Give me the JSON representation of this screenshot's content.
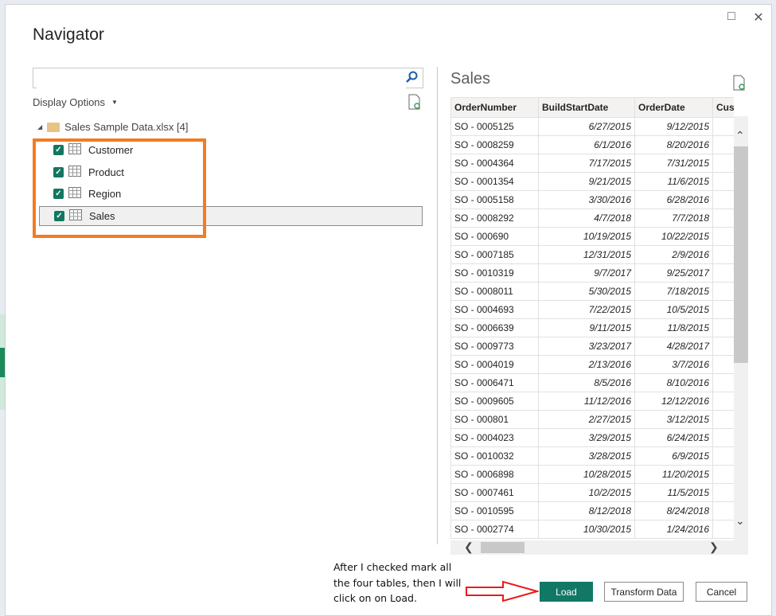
{
  "dialog": {
    "title": "Navigator",
    "restore_icon": "restore-icon",
    "close_icon": "close-icon"
  },
  "left": {
    "search": {
      "value": "",
      "placeholder": ""
    },
    "display_options": "Display Options",
    "tree_root": "Sales Sample Data.xlsx [4]",
    "items": [
      {
        "label": "Customer",
        "checked": true
      },
      {
        "label": "Product",
        "checked": true
      },
      {
        "label": "Region",
        "checked": true
      },
      {
        "label": "Sales",
        "checked": true,
        "selected": true
      }
    ]
  },
  "preview": {
    "title": "Sales",
    "columns": [
      "OrderNumber",
      "BuildStartDate",
      "OrderDate",
      "Custom"
    ],
    "rows": [
      [
        "SO - 0005125",
        "6/27/2015",
        "9/12/2015"
      ],
      [
        "SO - 0008259",
        "6/1/2016",
        "8/20/2016"
      ],
      [
        "SO - 0004364",
        "7/17/2015",
        "7/31/2015"
      ],
      [
        "SO - 0001354",
        "9/21/2015",
        "11/6/2015"
      ],
      [
        "SO - 0005158",
        "3/30/2016",
        "6/28/2016"
      ],
      [
        "SO - 0008292",
        "4/7/2018",
        "7/7/2018"
      ],
      [
        "SO - 000690",
        "10/19/2015",
        "10/22/2015"
      ],
      [
        "SO - 0007185",
        "12/31/2015",
        "2/9/2016"
      ],
      [
        "SO - 0010319",
        "9/7/2017",
        "9/25/2017"
      ],
      [
        "SO - 0008011",
        "5/30/2015",
        "7/18/2015"
      ],
      [
        "SO - 0004693",
        "7/22/2015",
        "10/5/2015"
      ],
      [
        "SO - 0006639",
        "9/11/2015",
        "11/8/2015"
      ],
      [
        "SO - 0009773",
        "3/23/2017",
        "4/28/2017"
      ],
      [
        "SO - 0004019",
        "2/13/2016",
        "3/7/2016"
      ],
      [
        "SO - 0006471",
        "8/5/2016",
        "8/10/2016"
      ],
      [
        "SO - 0009605",
        "11/12/2016",
        "12/12/2016"
      ],
      [
        "SO - 000801",
        "2/27/2015",
        "3/12/2015"
      ],
      [
        "SO - 0004023",
        "3/29/2015",
        "6/24/2015"
      ],
      [
        "SO - 0010032",
        "3/28/2015",
        "6/9/2015"
      ],
      [
        "SO - 0006898",
        "10/28/2015",
        "11/20/2015"
      ],
      [
        "SO - 0007461",
        "10/2/2015",
        "11/5/2015"
      ],
      [
        "SO - 0010595",
        "8/12/2018",
        "8/24/2018"
      ],
      [
        "SO - 0002774",
        "10/30/2015",
        "1/24/2016"
      ]
    ]
  },
  "buttons": {
    "load": "Load",
    "transform": "Transform Data",
    "cancel": "Cancel"
  },
  "annotation": {
    "text": "After I checked mark all the four tables, then I will click on on Load.",
    "highlight_color": "#f47b20",
    "arrow_color": "#e81c1c"
  },
  "colors": {
    "accent": "#117865"
  }
}
